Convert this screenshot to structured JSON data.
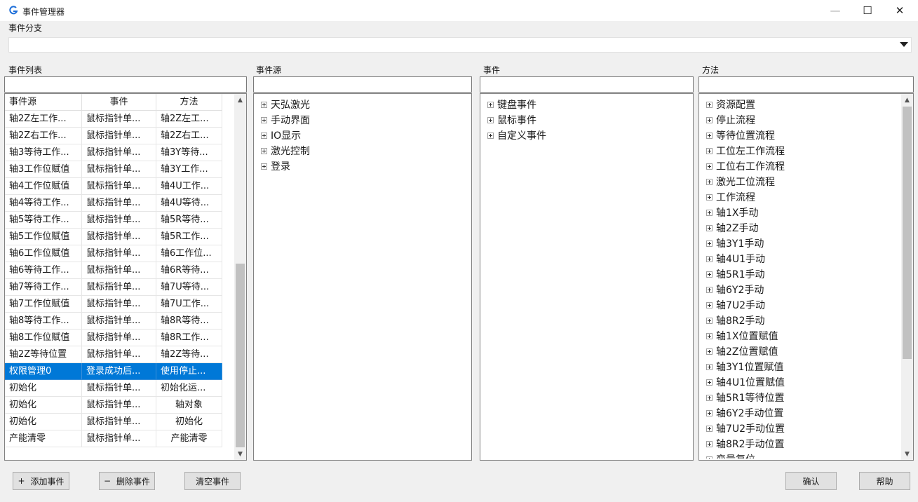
{
  "window": {
    "title": "事件管理器"
  },
  "branch": {
    "label": "事件分支",
    "value": ""
  },
  "event_list": {
    "label": "事件列表",
    "filter": "",
    "columns": [
      "事件源",
      "事件",
      "方法"
    ],
    "rows": [
      [
        "轴2Z左工作...",
        "鼠标指针单...",
        "轴2Z左工..."
      ],
      [
        "轴2Z右工作...",
        "鼠标指针单...",
        "轴2Z右工..."
      ],
      [
        "轴3等待工作...",
        "鼠标指针单...",
        "轴3Y等待..."
      ],
      [
        "轴3工作位赋值",
        "鼠标指针单...",
        "轴3Y工作..."
      ],
      [
        "轴4工作位赋值",
        "鼠标指针单...",
        "轴4U工作..."
      ],
      [
        "轴4等待工作...",
        "鼠标指针单...",
        "轴4U等待..."
      ],
      [
        "轴5等待工作...",
        "鼠标指针单...",
        "轴5R等待..."
      ],
      [
        "轴5工作位赋值",
        "鼠标指针单...",
        "轴5R工作..."
      ],
      [
        "轴6工作位赋值",
        "鼠标指针单...",
        "轴6工作位..."
      ],
      [
        "轴6等待工作...",
        "鼠标指针单...",
        "轴6R等待..."
      ],
      [
        "轴7等待工作...",
        "鼠标指针单...",
        "轴7U等待..."
      ],
      [
        "轴7工作位赋值",
        "鼠标指针单...",
        "轴7U工作..."
      ],
      [
        "轴8等待工作...",
        "鼠标指针单...",
        "轴8R等待..."
      ],
      [
        "轴8工作位赋值",
        "鼠标指针单...",
        "轴8R工作..."
      ],
      [
        "轴2Z等待位置",
        "鼠标指针单...",
        "轴2Z等待..."
      ],
      [
        "权限管理0",
        "登录成功后...",
        "使用停止..."
      ],
      [
        "初始化",
        "鼠标指针单...",
        "初始化运..."
      ],
      [
        "初始化",
        "鼠标指针单...",
        "轴对象"
      ],
      [
        "初始化",
        "鼠标指针单...",
        "初始化"
      ],
      [
        "产能清零",
        "鼠标指针单...",
        "产能清零"
      ]
    ],
    "selected_row": 15
  },
  "source": {
    "label": "事件源",
    "filter": "",
    "items": [
      "天弘激光",
      "手动界面",
      "IO显示",
      "激光控制",
      "登录"
    ]
  },
  "event": {
    "label": "事件",
    "filter": "",
    "items": [
      "键盘事件",
      "鼠标事件",
      "自定义事件"
    ]
  },
  "method": {
    "label": "方法",
    "filter": "",
    "items": [
      "资源配置",
      "停止流程",
      "等待位置流程",
      "工位左工作流程",
      "工位右工作流程",
      "激光工位流程",
      "工作流程",
      "轴1X手动",
      "轴2Z手动",
      "轴3Y1手动",
      "轴4U1手动",
      "轴5R1手动",
      "轴6Y2手动",
      "轴7U2手动",
      "轴8R2手动",
      "轴1X位置赋值",
      "轴2Z位置赋值",
      "轴3Y1位置赋值",
      "轴4U1位置赋值",
      "轴5R1等待位置",
      "轴6Y2手动位置",
      "轴7U2手动位置",
      "轴8R2手动位置",
      "变量复位"
    ]
  },
  "buttons": {
    "add": "添加事件",
    "delete": "删除事件",
    "clear": "清空事件",
    "confirm": "确认",
    "help": "帮助"
  },
  "icons": {
    "add": "+",
    "delete": "−",
    "minimize": "—",
    "maximize": "☐",
    "close": "✕",
    "scroll_up": "▲",
    "scroll_down": "▼"
  },
  "colors": {
    "selection": "#0078d7",
    "app_icon": "#1e6fd9"
  }
}
